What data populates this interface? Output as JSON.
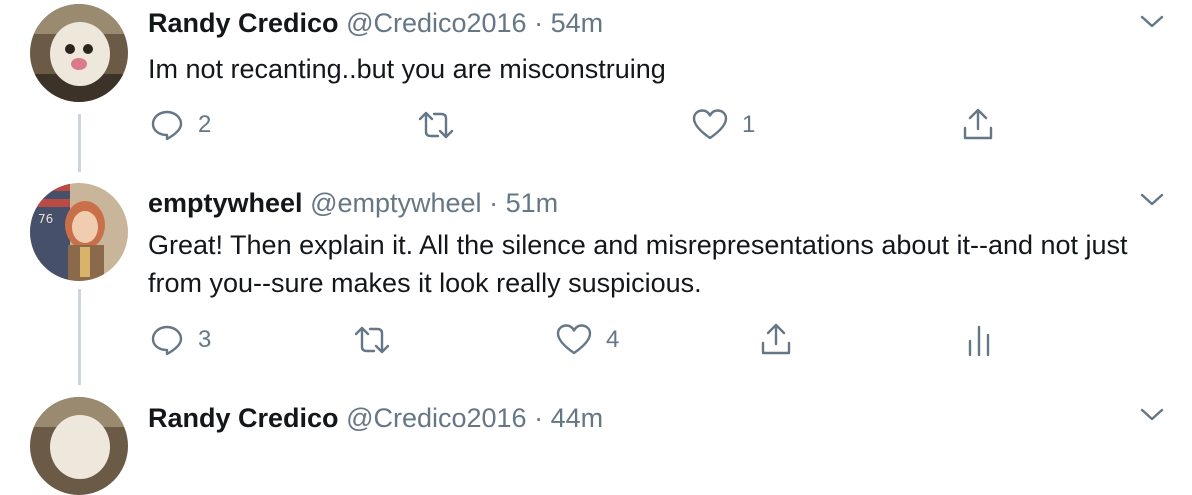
{
  "tweets": [
    {
      "name": "Randy Credico",
      "handle": "@Credico2016",
      "separator": "·",
      "time": "54m",
      "text": "Im not recanting..but you are misconstruing",
      "actions": {
        "reply_count": "2",
        "retweet_count": "",
        "like_count": "1"
      }
    },
    {
      "name": "emptywheel",
      "handle": "@emptywheel",
      "separator": "·",
      "time": "51m",
      "text": "Great! Then explain it. All the silence and misrepresentations about it--and not just from you--sure makes it look really suspicious.",
      "actions": {
        "reply_count": "3",
        "retweet_count": "",
        "like_count": "4"
      }
    },
    {
      "name": "Randy Credico",
      "handle": "@Credico2016",
      "separator": "·",
      "time": "44m"
    }
  ],
  "icons": {
    "reply": "reply-icon",
    "retweet": "retweet-icon",
    "like": "heart-icon",
    "share": "share-icon",
    "analytics": "analytics-icon",
    "more": "chevron-down-icon"
  },
  "colors": {
    "text": "#14171a",
    "secondary": "#657786",
    "thread_line": "#ccd6dd"
  }
}
